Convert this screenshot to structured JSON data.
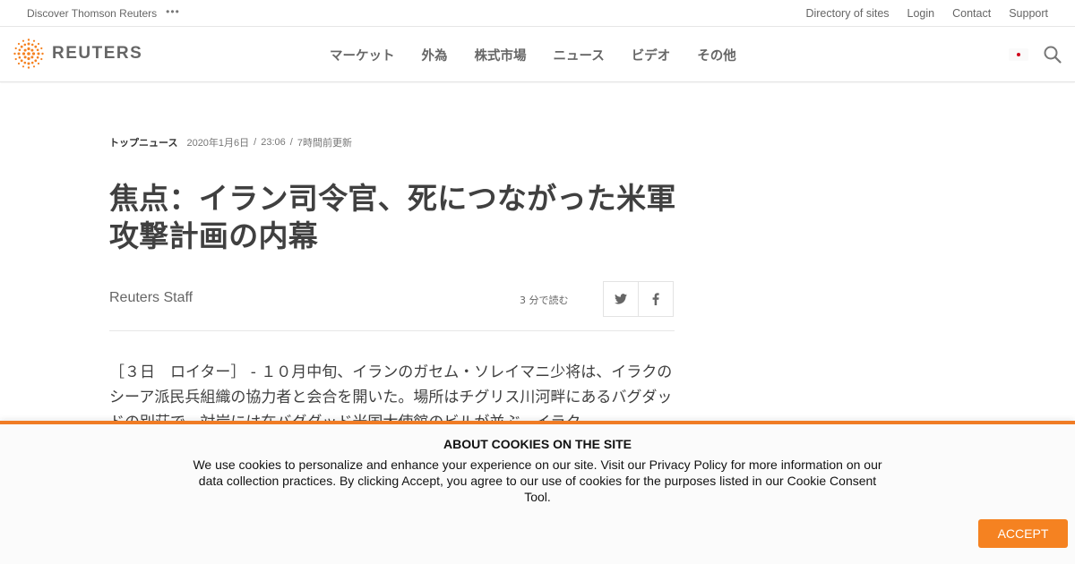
{
  "utility_bar": {
    "discover": "Discover Thomson Reuters",
    "more": "•••",
    "links": [
      "Directory of sites",
      "Login",
      "Contact",
      "Support"
    ]
  },
  "header": {
    "logo_text": "REUTERS",
    "nav": [
      "マーケット",
      "外為",
      "株式市場",
      "ニュース",
      "ビデオ",
      "その他"
    ]
  },
  "article": {
    "section": "トップニュース",
    "date": "2020年1月6日",
    "time": "23:06",
    "updated": "7時間前更新",
    "headline": "焦点：イラン司令官、死につながった米軍攻撃計画の内幕",
    "author": "Reuters Staff",
    "read_time": "3  分で読む",
    "body": "［３日　ロイター］ - １０月中旬、イランのガセム・ソレイマニ少将は、イラクのシーア派民兵組織の協力者と会合を開いた。場所はチグリス川河畔にあるバグダッドの別荘で、対岸には在バグダッド米国大使館のビルが並ぶ。イラク"
  },
  "cookie_banner": {
    "title": "ABOUT COOKIES ON THE SITE",
    "text": "We use cookies to personalize and enhance your experience on our site. Visit our Privacy Policy for more information on our data collection practices. By clicking Accept, you agree to our use of cookies for the purposes listed in our Cookie Consent Tool.",
    "accept_label": "ACCEPT"
  },
  "colors": {
    "accent": "#f58221",
    "banner_border": "#f07c25",
    "text": "#404040"
  }
}
